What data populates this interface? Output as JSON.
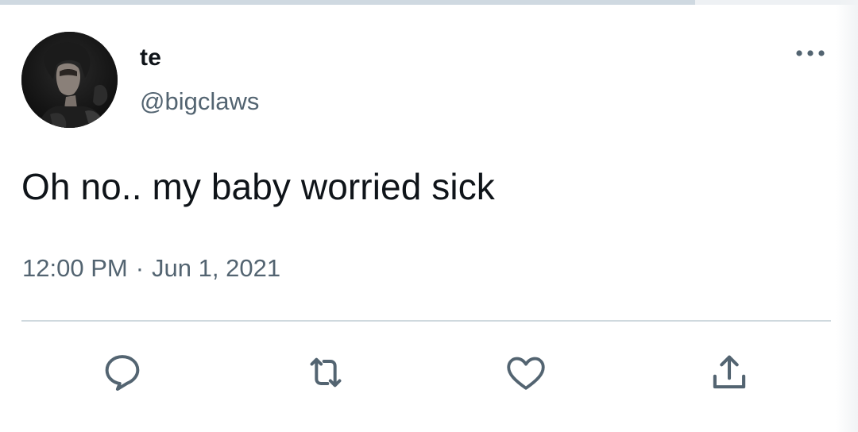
{
  "tweet": {
    "display_name": "te",
    "handle": "@bigclaws",
    "text": "Oh no.. my baby worried sick",
    "time": "12:00 PM",
    "separator": "·",
    "date": "Jun 1, 2021"
  },
  "top_progress": {
    "fraction": 0.81
  },
  "icons": {
    "more": "more-horizontal-icon",
    "reply": "reply-icon",
    "retweet": "retweet-icon",
    "like": "like-heart-icon",
    "share": "share-icon"
  },
  "colors": {
    "text_primary": "#0f1419",
    "text_secondary": "#536471",
    "divider": "#cfd9de"
  }
}
